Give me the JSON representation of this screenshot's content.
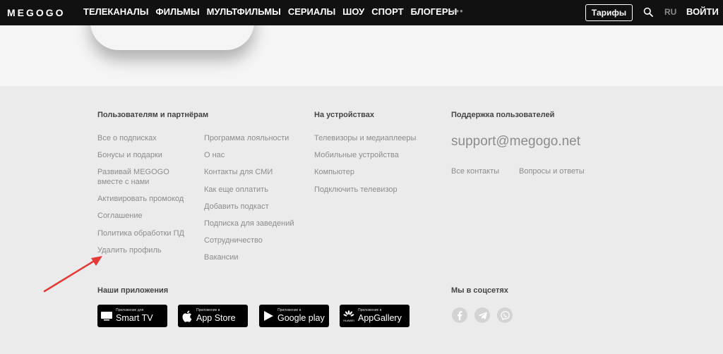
{
  "header": {
    "logo": "MEGOGO",
    "nav": [
      "ТЕЛЕКАНАЛЫ",
      "ФИЛЬМЫ",
      "МУЛЬТФИЛЬМЫ",
      "СЕРИАЛЫ",
      "ШОУ",
      "СПОРТ",
      "БЛОГЕРЫ"
    ],
    "more": "•••",
    "tariffs_label": "Тарифы",
    "lang": "RU",
    "login_label": "ВОЙТИ"
  },
  "footer": {
    "users_title": "Пользователям и партнёрам",
    "users_col1": [
      "Все о подписках",
      "Бонусы и подарки",
      "Развивай MEGOGO\nвместе с нами",
      "Активировать промокод",
      "Соглашение",
      "Политика обработки ПД",
      "Удалить профиль"
    ],
    "users_col2": [
      "Программа лояльности",
      "О нас",
      "Контакты для СМИ",
      "Как еще оплатить",
      "Добавить подкаст",
      "Подписка для заведений",
      "Сотрудничество",
      "Вакансии"
    ],
    "devices_title": "На устройствах",
    "devices": [
      "Телевизоры и медиаплееры",
      "Мобильные устройства",
      "Компьютер",
      "Подключить телевизор"
    ],
    "support_title": "Поддержка пользователей",
    "support_email": "support@megogo.net",
    "support_links": [
      "Все контакты",
      "Вопросы и ответы"
    ],
    "apps_title": "Наши приложения",
    "apps": [
      {
        "small": "Приложение для",
        "big": "Smart TV",
        "icon": "tv-icon"
      },
      {
        "small": "Приложение в",
        "big": "App Store",
        "icon": "apple-icon"
      },
      {
        "small": "Приложение в",
        "big": "Google play",
        "icon": "google-play-icon"
      },
      {
        "small": "Приложение в",
        "big": "AppGallery",
        "icon": "huawei-icon"
      }
    ],
    "huawei_label": "HUAWEI",
    "social_title": "Мы в соцсетях",
    "social": [
      "facebook-icon",
      "telegram-icon",
      "viber-icon"
    ]
  },
  "colors": {
    "header_bg": "#111111",
    "footer_bg": "#ebebeb",
    "arrow": "#e53935"
  }
}
